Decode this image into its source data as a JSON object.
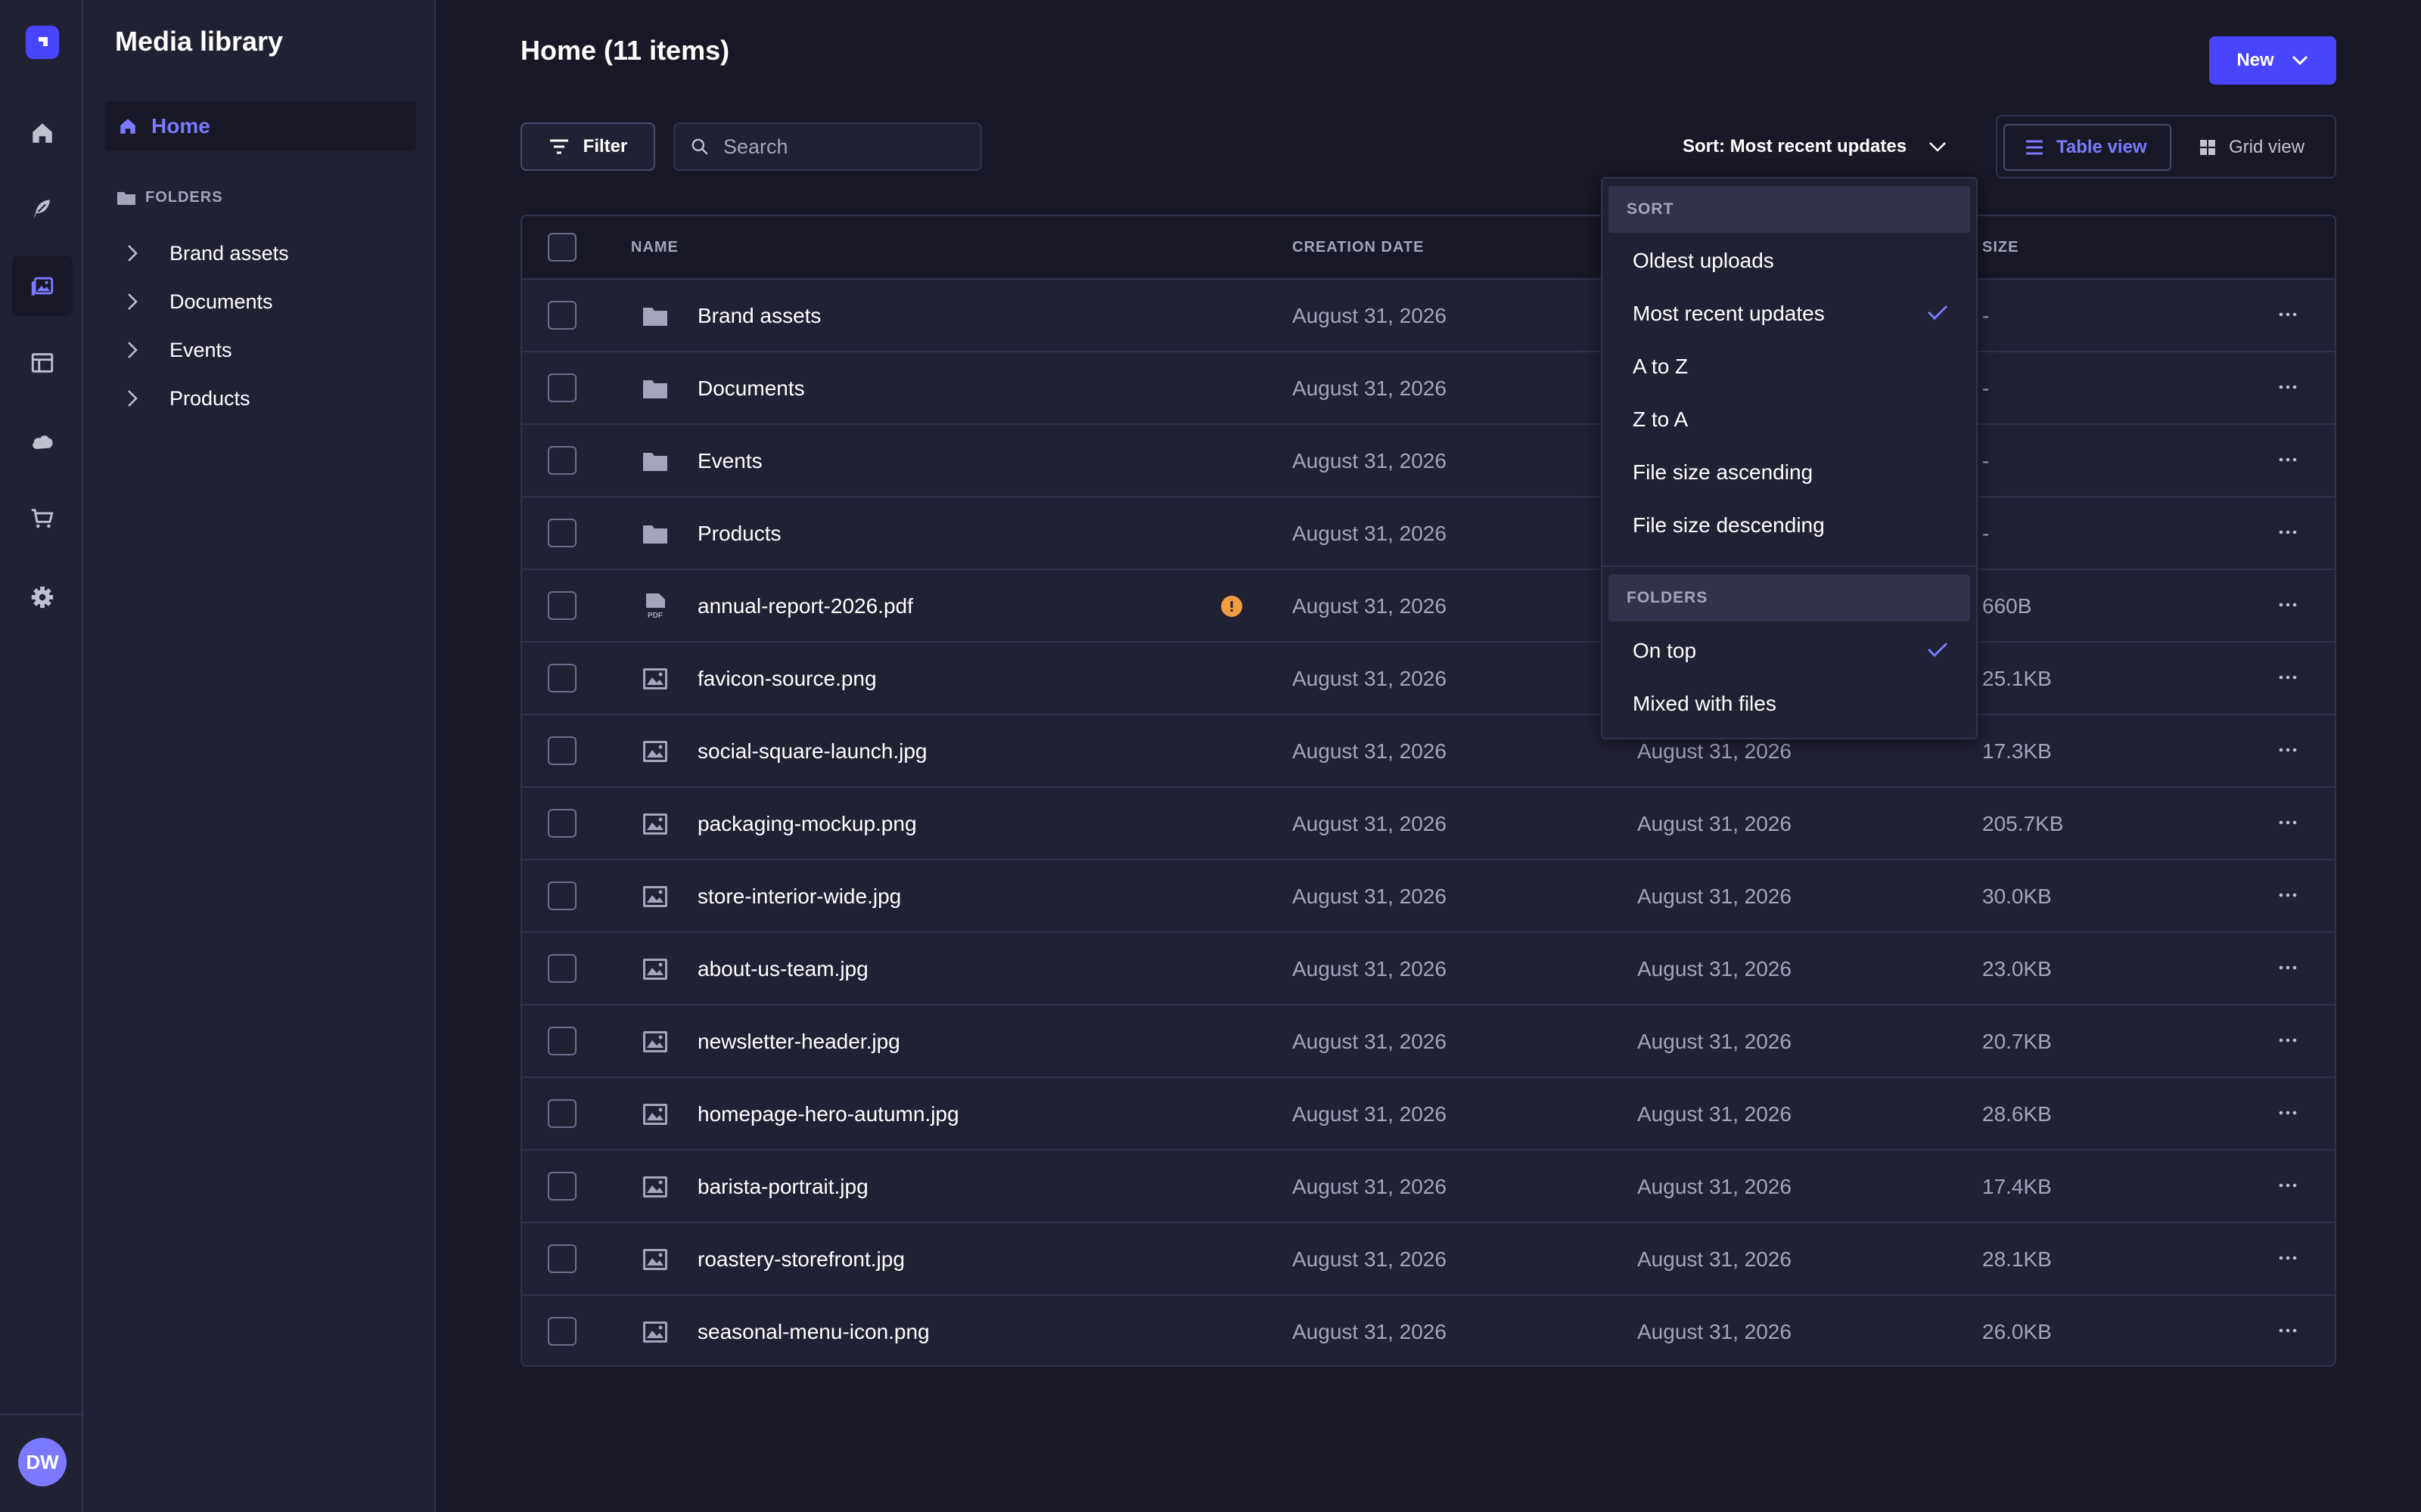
{
  "sidebar": {
    "nav_icons": [
      "home-icon",
      "feather-icon",
      "media-icon",
      "layout-icon",
      "cloud-icon",
      "cart-icon",
      "gear-icon"
    ],
    "avatar_initials": "DW"
  },
  "subnav": {
    "title": "Media library",
    "home_label": "Home",
    "folders_heading": "FOLDERS",
    "folders": [
      "Brand assets",
      "Documents",
      "Events",
      "Products"
    ]
  },
  "header": {
    "title": "Home (11 items)",
    "new_label": "New"
  },
  "toolbar": {
    "filter_label": "Filter",
    "search_placeholder": "Search",
    "sort_label": "Sort: Most recent updates",
    "table_view_label": "Table view",
    "grid_view_label": "Grid view"
  },
  "table": {
    "columns": {
      "name": "NAME",
      "creation_date": "CREATION DATE",
      "size": "SIZE"
    },
    "rows": [
      {
        "type": "folder",
        "name": "Brand assets",
        "created": "August 31, 2026",
        "updated": "",
        "size": "-"
      },
      {
        "type": "folder",
        "name": "Documents",
        "created": "August 31, 2026",
        "updated": "",
        "size": "-"
      },
      {
        "type": "folder",
        "name": "Events",
        "created": "August 31, 2026",
        "updated": "",
        "size": "-"
      },
      {
        "type": "folder",
        "name": "Products",
        "created": "August 31, 2026",
        "updated": "",
        "size": "-"
      },
      {
        "type": "pdf",
        "name": "annual-report-2026.pdf",
        "created": "August 31, 2026",
        "updated": "",
        "size": "660B",
        "warning": true
      },
      {
        "type": "image",
        "name": "favicon-source.png",
        "created": "August 31, 2026",
        "updated": "",
        "size": "25.1KB"
      },
      {
        "type": "image",
        "name": "social-square-launch.jpg",
        "created": "August 31, 2026",
        "updated": "August 31, 2026",
        "size": "17.3KB"
      },
      {
        "type": "image",
        "name": "packaging-mockup.png",
        "created": "August 31, 2026",
        "updated": "August 31, 2026",
        "size": "205.7KB"
      },
      {
        "type": "image",
        "name": "store-interior-wide.jpg",
        "created": "August 31, 2026",
        "updated": "August 31, 2026",
        "size": "30.0KB"
      },
      {
        "type": "image",
        "name": "about-us-team.jpg",
        "created": "August 31, 2026",
        "updated": "August 31, 2026",
        "size": "23.0KB"
      },
      {
        "type": "image",
        "name": "newsletter-header.jpg",
        "created": "August 31, 2026",
        "updated": "August 31, 2026",
        "size": "20.7KB"
      },
      {
        "type": "image",
        "name": "homepage-hero-autumn.jpg",
        "created": "August 31, 2026",
        "updated": "August 31, 2026",
        "size": "28.6KB"
      },
      {
        "type": "image",
        "name": "barista-portrait.jpg",
        "created": "August 31, 2026",
        "updated": "August 31, 2026",
        "size": "17.4KB"
      },
      {
        "type": "image",
        "name": "roastery-storefront.jpg",
        "created": "August 31, 2026",
        "updated": "August 31, 2026",
        "size": "28.1KB"
      },
      {
        "type": "image",
        "name": "seasonal-menu-icon.png",
        "created": "August 31, 2026",
        "updated": "August 31, 2026",
        "size": "26.0KB"
      }
    ]
  },
  "sort_menu": {
    "sort_heading": "SORT",
    "sort_options": [
      {
        "label": "Oldest uploads",
        "selected": false
      },
      {
        "label": "Most recent updates",
        "selected": true
      },
      {
        "label": "A to Z",
        "selected": false
      },
      {
        "label": "Z to A",
        "selected": false
      },
      {
        "label": "File size ascending",
        "selected": false
      },
      {
        "label": "File size descending",
        "selected": false
      }
    ],
    "folders_heading": "FOLDERS",
    "folder_options": [
      {
        "label": "On top",
        "selected": true
      },
      {
        "label": "Mixed with files",
        "selected": false
      }
    ]
  },
  "colors": {
    "accent": "#4945ff",
    "accent_text": "#7b79ff",
    "background": "#181826",
    "surface": "#212134",
    "border": "#32324d",
    "muted_text": "#a5a5ba",
    "warning": "#f29d41"
  }
}
